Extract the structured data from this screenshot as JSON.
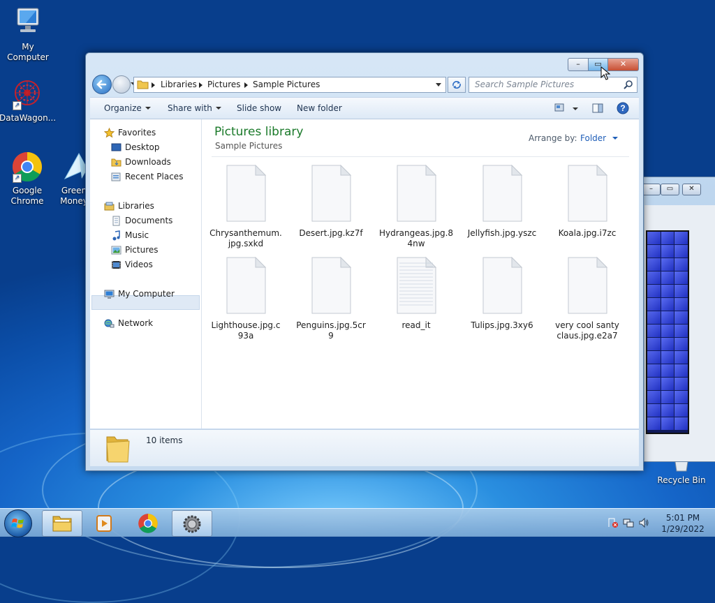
{
  "desktop": {
    "icons": [
      {
        "label": "My Computer"
      },
      {
        "label": "DataWagon..."
      },
      {
        "label": "Google Chrome"
      },
      {
        "label": "Green Money"
      },
      {
        "label": "Recycle Bin"
      }
    ]
  },
  "window": {
    "caption_buttons": {
      "minimize": "–",
      "maximize": "▭",
      "close": "✕"
    },
    "breadcrumb": [
      "Libraries",
      "Pictures",
      "Sample Pictures"
    ],
    "search_placeholder": "Search Sample Pictures",
    "toolbar": {
      "organize": "Organize",
      "share_with": "Share with",
      "slide_show": "Slide show",
      "new_folder": "New folder"
    },
    "nav": {
      "favorites": "Favorites",
      "desktop": "Desktop",
      "downloads": "Downloads",
      "recent_places": "Recent Places",
      "libraries": "Libraries",
      "documents": "Documents",
      "music": "Music",
      "pictures": "Pictures",
      "videos": "Videos",
      "my_computer": "My Computer",
      "network": "Network",
      "selected": "Pictures"
    },
    "content": {
      "title": "Pictures library",
      "subtitle": "Sample Pictures",
      "arrange_label": "Arrange by:",
      "arrange_value": "Folder"
    },
    "files": [
      {
        "name": "Chrysanthemum.\njpg.sxkd",
        "kind": "blank"
      },
      {
        "name": "Desert.jpg.kz7f",
        "kind": "blank"
      },
      {
        "name": "Hydrangeas.jpg.8\n4nw",
        "kind": "blank"
      },
      {
        "name": "Jellyfish.jpg.yszc",
        "kind": "blank"
      },
      {
        "name": "Koala.jpg.i7zc",
        "kind": "blank"
      },
      {
        "name": "Lighthouse.jpg.c\n93a",
        "kind": "blank"
      },
      {
        "name": "Penguins.jpg.5cr\n9",
        "kind": "blank"
      },
      {
        "name": "read_it",
        "kind": "text"
      },
      {
        "name": "Tulips.jpg.3xy6",
        "kind": "blank"
      },
      {
        "name": "very cool santy\nclaus.jpg.e2a7",
        "kind": "blank"
      }
    ],
    "status": "10 items"
  },
  "background_window": {
    "buttons": {
      "minimize": "–",
      "maximize": "▭",
      "close": "✕"
    }
  },
  "taskbar": {
    "time": "5:01 PM",
    "date": "1/29/2022"
  }
}
